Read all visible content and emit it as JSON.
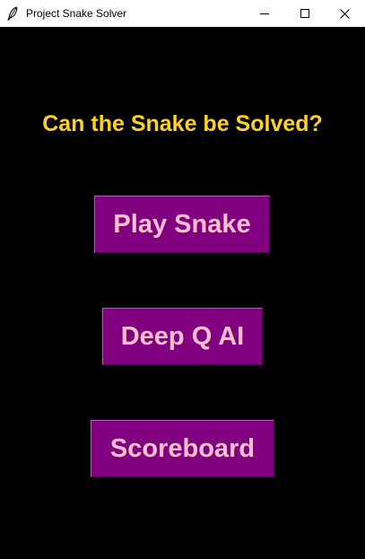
{
  "window": {
    "title": "Project Snake Solver",
    "app_icon": "feather-icon",
    "controls": {
      "minimize_icon": "minimize-icon",
      "maximize_icon": "maximize-icon",
      "close_icon": "close-icon"
    }
  },
  "main": {
    "heading": "Can the Snake be Solved?",
    "buttons": [
      {
        "label": "Play Snake"
      },
      {
        "label": "Deep Q AI"
      },
      {
        "label": "Scoreboard"
      }
    ]
  },
  "colors": {
    "background": "#000000",
    "heading": "#ffd21f",
    "button_bg": "#800080",
    "button_text": "#ffc0cb",
    "titlebar": "#ffffff"
  }
}
